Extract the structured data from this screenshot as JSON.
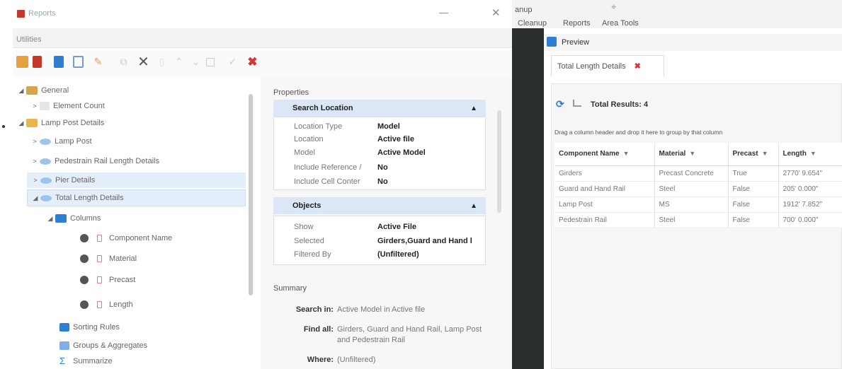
{
  "reports_window": {
    "title": "Reports",
    "utilities_label": "Utilities"
  },
  "tree": {
    "general": "General",
    "element_count": "Element Count",
    "lamp_post_details": "Lamp Post Details",
    "lamp_post": "Lamp Post",
    "pedestrain_rail": "Pedestrain Rail Length Details",
    "pier_details": "Pier Details",
    "total_length": "Total Length Details",
    "columns": "Columns",
    "col_items": [
      "Component Name",
      "Material",
      "Precast",
      "Length"
    ],
    "sorting_rules": "Sorting Rules",
    "groups": "Groups & Aggregates",
    "summarize": "Summarize"
  },
  "properties": {
    "header": "Properties",
    "search_location": {
      "title": "Search Location",
      "rows": [
        {
          "k": "Location Type",
          "v": "Model"
        },
        {
          "k": "Location",
          "v": "Active file"
        },
        {
          "k": "Model",
          "v": "Active Model"
        },
        {
          "k": "Include Reference /",
          "v": "No"
        },
        {
          "k": "Include Cell Conter",
          "v": "No"
        }
      ]
    },
    "objects": {
      "title": "Objects",
      "rows": [
        {
          "k": "Show",
          "v": "Active File"
        },
        {
          "k": "Selected",
          "v": "Girders,Guard and Hand l"
        },
        {
          "k": "Filtered By",
          "v": "(Unfiltered)"
        }
      ]
    }
  },
  "summary": {
    "title": "Summary",
    "search_in_k": "Search in:",
    "search_in_v": "Active Model  in Active file",
    "find_all_k": "Find all:",
    "find_all_v1": "Girders, Guard and Hand Rail, Lamp Post",
    "find_all_v2": "and Pedestrain Rail",
    "where_k": "Where:",
    "where_v": "(Unfiltered)"
  },
  "ribbon": {
    "cleanup_top": "anup",
    "cleanup": "Cleanup",
    "reports": "Reports",
    "area_tools": "Area Tools"
  },
  "preview": {
    "title": "Preview",
    "tab": "Total Length Details",
    "results": "Total Results: 4",
    "drag_hint": "Drag a column header and drop it here to group by that column",
    "columns": [
      "Component Name",
      "Material",
      "Precast",
      "Length"
    ],
    "rows": [
      [
        "Girders",
        "Precast Concrete",
        "True",
        "2770' 9.654\""
      ],
      [
        "Guard and Hand Rail",
        "Steel",
        "False",
        "205' 0.000\""
      ],
      [
        "Lamp Post",
        "MS",
        "False",
        "1912' 7.852\""
      ],
      [
        "Pedestrain Rail",
        "Steel",
        "False",
        "700' 0.000\""
      ]
    ]
  },
  "colors": {
    "accent": "#2e7fd1",
    "selection": "#e5eefb",
    "close_red": "#d6362f",
    "dark_canvas": "#2b2e2f"
  }
}
